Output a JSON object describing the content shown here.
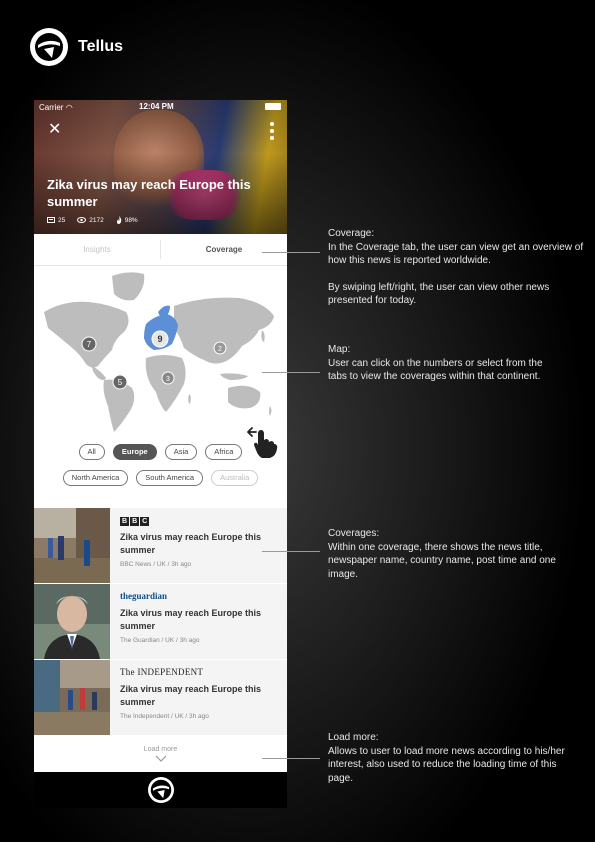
{
  "brand": {
    "name": "Tellus"
  },
  "status_bar": {
    "carrier": "Carrier",
    "time": "12:04 PM"
  },
  "article": {
    "title": "Zika virus may reach Europe this summer",
    "stats": {
      "comments": "25",
      "views": "2172",
      "hot": "98%"
    }
  },
  "tabs": [
    {
      "label": "Insights",
      "active": false
    },
    {
      "label": "Coverage",
      "active": true
    }
  ],
  "map": {
    "continent_counts": {
      "north_america": "7",
      "europe": "9",
      "asia": "2",
      "africa": "3",
      "south_america": "5"
    },
    "highlight_color": "#5b8fd6"
  },
  "continent_chips": [
    {
      "label": "All",
      "state": "normal"
    },
    {
      "label": "Europe",
      "state": "active"
    },
    {
      "label": "Asia",
      "state": "normal"
    },
    {
      "label": "Africa",
      "state": "normal"
    },
    {
      "label": "North America",
      "state": "normal"
    },
    {
      "label": "South America",
      "state": "normal"
    },
    {
      "label": "Australia",
      "state": "disabled"
    }
  ],
  "news": [
    {
      "paper": "BBC",
      "title": "Zika virus may reach Europe this summer",
      "meta": "BBC News / UK / 3h ago"
    },
    {
      "paper": "theguardian",
      "title": "Zika virus may reach Europe this summer",
      "meta": "The Guardian / UK / 3h ago"
    },
    {
      "paper": "The INDEPENDENT",
      "title": "Zika virus may reach Europe this summer",
      "meta": "The Independent / UK /  3h ago"
    }
  ],
  "load_more": {
    "label": "Load more"
  },
  "annotations": {
    "coverage": {
      "heading": "Coverage:",
      "text": "In the Coverage tab, the user can view get an overview of how this news is reported worldwide.",
      "text2": "By swiping left/right, the user can view other news presented for today."
    },
    "map": {
      "heading": "Map:",
      "text": "User can click on the numbers or select from the tabs to view the coverages within that continent."
    },
    "coverages": {
      "heading": "Coverages:",
      "text": "Within one coverage, there shows the news title, newspaper name, country name, post time and one image."
    },
    "load_more": {
      "heading": "Load more:",
      "text": "Allows to user to load more news according to his/her interest, also used to reduce the loading time of this page."
    }
  }
}
